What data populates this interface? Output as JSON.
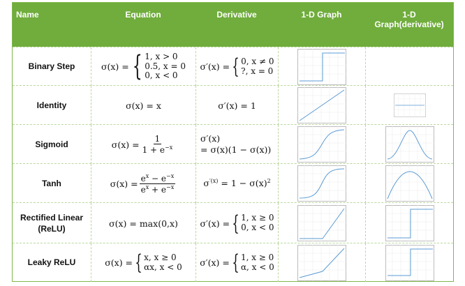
{
  "headers": {
    "name": "Name",
    "equation": "Equation",
    "derivative": "Derivative",
    "graph": "1-D Graph",
    "graph_derivative_1": "1-D",
    "graph_derivative_2": "Graph(derivative)"
  },
  "rows": [
    {
      "name": "Binary Step",
      "eq_lhs": "σ(x) =",
      "eq_cases": [
        "1,  x > 0",
        "0.5, x = 0",
        "0,  x < 0"
      ],
      "der_lhs": "σ′(x) =",
      "der_cases": [
        "0, x ≠ 0",
        "?, x = 0"
      ]
    },
    {
      "name": "Identity",
      "eq_text": "σ(x) = x",
      "der_text": "σ′(x) = 1"
    },
    {
      "name": "Sigmoid",
      "eq_lhs": "σ(x) =",
      "eq_num": "1",
      "eq_den": "1 + e",
      "eq_den_sup": "−x",
      "der_line1": "σ′(x)",
      "der_line2": "= σ(x)(1 − σ(x))"
    },
    {
      "name": "Tanh",
      "eq_lhs": "σ(x) =",
      "eq_num_a": "e",
      "eq_num_a_sup": "x",
      "eq_num_b": " − e",
      "eq_num_b_sup": "−x",
      "eq_den_a": "e",
      "eq_den_a_sup": "x",
      "eq_den_b": " + e",
      "eq_den_b_sup": "−x",
      "der_a": "σ",
      "der_a_sup": "′(x)",
      "der_b": " = 1 − σ(x)",
      "der_b_sup": "2"
    },
    {
      "name_1": "Rectified Linear",
      "name_2": "(ReLU)",
      "eq_text": "σ(x) = max(0,x)",
      "der_lhs": "σ′(x) =",
      "der_cases": [
        "1, x ≥ 0",
        "0, x < 0"
      ]
    },
    {
      "name": "Leaky ReLU",
      "eq_lhs": "σ(x) =",
      "eq_cases": [
        "x,  x ≥ 0",
        "αx, x < 0"
      ],
      "der_lhs": "σ′(x) =",
      "der_cases": [
        "1, x ≥ 0",
        "α, x < 0"
      ]
    }
  ]
}
